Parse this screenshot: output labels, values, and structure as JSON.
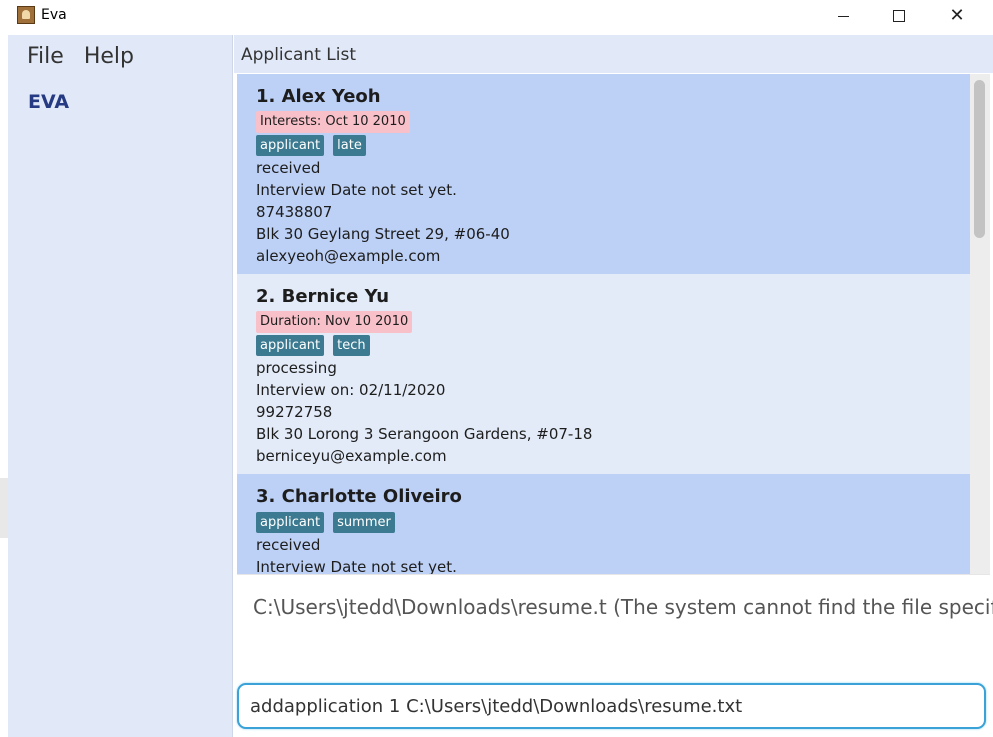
{
  "window": {
    "title": "Eva",
    "icon": "app-icon",
    "controls": {
      "minimize": "minimize-icon",
      "maximize": "maximize-icon",
      "close_glyph": "✕"
    }
  },
  "menu": {
    "file": "File",
    "help": "Help"
  },
  "brand": "EVA",
  "list": {
    "header": "Applicant List",
    "applicants": [
      {
        "name": "1.  Alex Yeoh",
        "highlight": "Interests: Oct 10 2010",
        "tags": [
          "applicant",
          "late"
        ],
        "status": "received",
        "interview": "Interview Date not set yet.",
        "phone": "87438807",
        "address": "Blk 30 Geylang Street 29, #06-40",
        "email": "alexyeoh@example.com"
      },
      {
        "name": "2.  Bernice Yu",
        "highlight": "Duration: Nov 10 2010",
        "tags": [
          "applicant",
          "tech"
        ],
        "status": "processing",
        "interview": "Interview on: 02/11/2020",
        "phone": "99272758",
        "address": "Blk 30 Lorong 3 Serangoon Gardens, #07-18",
        "email": "berniceyu@example.com"
      },
      {
        "name": "3.  Charlotte Oliveiro",
        "tags": [
          "applicant",
          "summer"
        ],
        "status": "received",
        "interview": "Interview Date not set yet."
      }
    ]
  },
  "result_message": "C:\\Users\\jtedd\\Downloads\\resume.t (The system cannot find the file specified)",
  "command_box": {
    "value": "addapplication 1 C:\\Users\\jtedd\\Downloads\\resume.txt"
  },
  "colors": {
    "sidebar_bg": "#e1e9f8",
    "selected_card": "#bdd0f5",
    "tag_bg": "#3b7a90",
    "highlight_bg": "#f8c1c9",
    "brand": "#253a82",
    "command_border": "#3aa2d6"
  }
}
